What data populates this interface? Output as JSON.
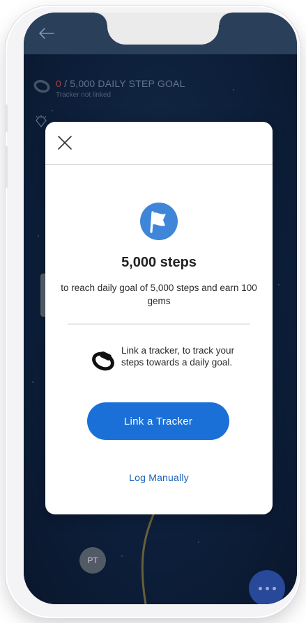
{
  "background_screen": {
    "goal_count": "0",
    "goal_rest": " / 5,000 DAILY STEP GOAL",
    "tracker_status": "Tracker not linked",
    "avatar_initials": "PT"
  },
  "modal": {
    "title": "5,000 steps",
    "description": "to reach daily goal of 5,000 steps and earn 100 gems",
    "tracker_message": "Link a tracker, to track your steps towards a daily goal.",
    "primary_button": "Link a Tracker",
    "secondary_link": "Log Manually"
  },
  "colors": {
    "accent_blue": "#1a70d6",
    "link_blue": "#1c63b7",
    "flag_blue": "#3f86d8",
    "background_navy": "#0f2240"
  },
  "icons": {
    "back": "arrow-left-icon",
    "close": "close-icon",
    "flag": "flag-icon",
    "tracker": "fitness-band-icon",
    "gem": "diamond-icon",
    "more": "more-dots-icon"
  }
}
